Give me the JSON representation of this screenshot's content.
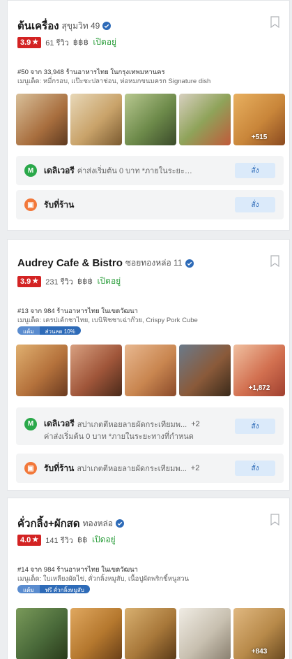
{
  "icons": {
    "bookmark": "bookmark-icon",
    "verified": "verified-badge-icon",
    "star": "star-icon",
    "delivery": "delivery-icon",
    "pickup": "pickup-icon"
  },
  "colors": {
    "rating_bg": "#d32323",
    "open_text": "#2a9d3a",
    "order_button_bg": "#dbeafa",
    "order_button_text": "#2e6bb8",
    "delivery_icon": "#2aa84a",
    "pickup_icon": "#f2783a"
  },
  "restaurants": [
    {
      "name": "ต้นเครื่อง",
      "branch": "สุขุมวิท 49",
      "rating": "3.9",
      "star": "★",
      "reviews": "61 รีวิว",
      "price": "฿฿฿",
      "status": "เปิดอยู่",
      "rank": "#50 จาก 33,948 ร้านอาหารไทย ในกรุงเทพมหานคร",
      "recommended": "เมนูเด็ด: หมี่กรอบ, แป๊ะซะปลาช่อน, ห่อหมกขนมครก Signature dish",
      "photos": [
        {
          "color": "#a86e3e"
        },
        {
          "color": "#c9a36a"
        },
        {
          "color": "#6d8a4a"
        },
        {
          "color": "#8fa35a"
        },
        {
          "color": "#c9863a",
          "more": "+515"
        }
      ],
      "delivery": {
        "label": "เดลิเวอรี",
        "desc": "ค่าส่งเริ่มต้น 0 บาท *ภายในระยะทางที่กำ...",
        "button": "สั่ง"
      },
      "pickup": {
        "label": "รับที่ร้าน",
        "button": "สั่ง"
      }
    },
    {
      "name": "Audrey Cafe & Bistro",
      "branch": "ซอยทองหล่อ 11",
      "rating": "3.9",
      "star": "★",
      "reviews": "231 รีวิว",
      "price": "฿฿฿",
      "status": "เปิดอยู่",
      "rank": "#13 จาก 984 ร้านอาหารไทย ในเขตวัฒนา",
      "recommended": "เมนูเด็ด: เครปเค้กชาไทย, เบนิฟิชชาเฉ่าก๊วย, Crispy Pork Cube",
      "promo": {
        "tag": "แต้ม",
        "text": "ส่วนลด 10%"
      },
      "photos": [
        {
          "color": "#b5723c"
        },
        {
          "color": "#a0563a"
        },
        {
          "color": "#c98650"
        },
        {
          "color": "#8a5a3a"
        },
        {
          "color": "#d27050",
          "more": "+1,872"
        }
      ],
      "delivery": {
        "label": "เดลิเวอรี",
        "desc": "สปาเกตตีหอยลายผัดกระเทียมพ...",
        "plus": "+2",
        "desc2": "ค่าส่งเริ่มต้น 0 บาท *ภายในระยะทางที่กำหนด",
        "button": "สั่ง"
      },
      "pickup": {
        "label": "รับที่ร้าน",
        "desc": "สปาเกตตีหอยลายผัดกระเทียมพ...",
        "plus": "+2",
        "button": "สั่ง"
      }
    },
    {
      "name": "คั่วกลิ้ง+ผักสด",
      "branch": "ทองหล่อ",
      "rating": "4.0",
      "star": "★",
      "reviews": "141 รีวิว",
      "price": "฿฿",
      "status": "เปิดอยู่",
      "rank": "#14 จาก 984 ร้านอาหารไทย ในเขตวัฒนา",
      "recommended": "เมนูเด็ด: ใบเหลียงผัดไข่, คั่วกลิ้งหมูสับ, เนื้อปูผัดพริกขี้หนูสวน",
      "promo": {
        "tag": "แต้ม",
        "text": "ฟรี คั่วกลิ้งหมูสับ"
      },
      "photos": [
        {
          "color": "#4a6a3a"
        },
        {
          "color": "#b5782e"
        },
        {
          "color": "#a8783a"
        },
        {
          "color": "#c8c0b0"
        },
        {
          "color": "#b88a4a",
          "more": "+843"
        }
      ]
    }
  ]
}
